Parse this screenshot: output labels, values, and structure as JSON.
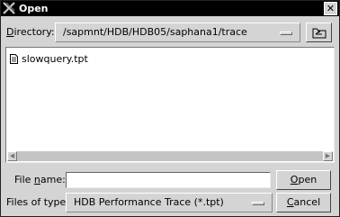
{
  "window": {
    "title": "Open",
    "close_glyph": "✕"
  },
  "directory": {
    "label_pre": "",
    "label_mnemonic": "D",
    "label_post": "irectory:",
    "value": "/sapmnt/HDB/HDB05/saphana1/trace",
    "up_icon": "folder-up-icon"
  },
  "files": [
    {
      "name": "slowquery.tpt",
      "icon": "file-icon"
    }
  ],
  "scrollbar": {
    "left_glyph": "◀",
    "right_glyph": "▶"
  },
  "file_name": {
    "label_pre": "File ",
    "label_mnemonic": "n",
    "label_post": "ame:",
    "value": "",
    "placeholder": ""
  },
  "files_of_type": {
    "label": "Files of type:",
    "value": "HDB Performance Trace (*.tpt)"
  },
  "buttons": {
    "open_mnemonic": "O",
    "open_rest": "pen",
    "cancel_mnemonic": "C",
    "cancel_rest": "ancel"
  },
  "colors": {
    "titlebar": "#000000",
    "dialog": "#d4d4d4",
    "list_background": "#ffffff"
  }
}
